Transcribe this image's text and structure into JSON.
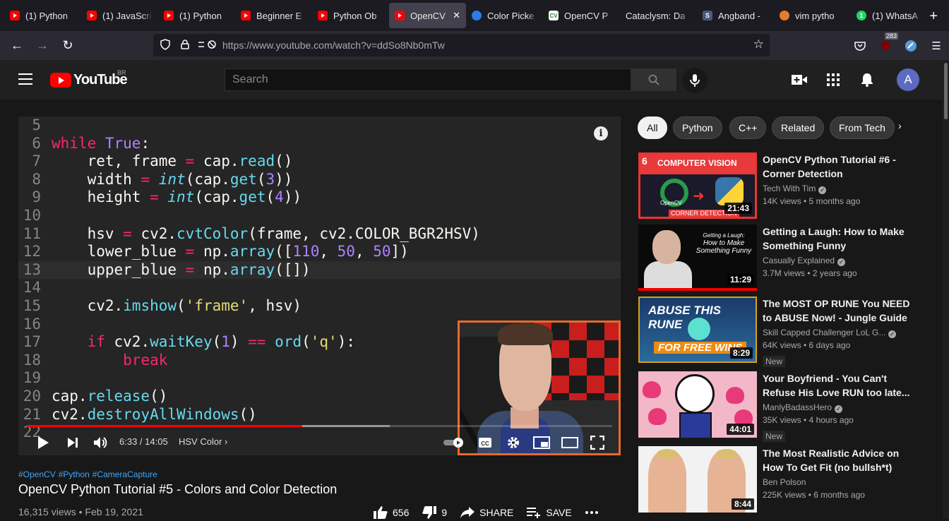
{
  "browser": {
    "tabs": [
      {
        "label": "(1) Python",
        "icon": "youtube-favicon"
      },
      {
        "label": "(1) JavaScri",
        "icon": "youtube-favicon"
      },
      {
        "label": "(1) Python",
        "icon": "youtube-favicon"
      },
      {
        "label": "Beginner E",
        "icon": "youtube-favicon"
      },
      {
        "label": "Python Ob",
        "icon": "youtube-favicon"
      },
      {
        "label": "OpenCV",
        "icon": "youtube-favicon",
        "active": true
      },
      {
        "label": "Color Picke",
        "icon": "color-picker-favicon"
      },
      {
        "label": "OpenCV P",
        "icon": "opencv-favicon"
      },
      {
        "label": "Cataclysm: Da",
        "icon": "none"
      },
      {
        "label": "Angband -",
        "icon": "angband-favicon"
      },
      {
        "label": "vim pytho",
        "icon": "duckduckgo-favicon"
      },
      {
        "label": "(1) WhatsA",
        "icon": "whatsapp-favicon"
      }
    ],
    "url": "https://www.youtube.com/watch?v=ddSo8Nb0mTw",
    "extension_badge": "283"
  },
  "youtube": {
    "logo_text": "YouTube",
    "country": "BR",
    "search_placeholder": "Search",
    "avatar_letter": "A"
  },
  "player": {
    "code_lines": [
      {
        "n": "5",
        "html": ""
      },
      {
        "n": "6",
        "html": "<span class='k'>while</span> <span class='kc'>True</span><span class='tx'>:</span>"
      },
      {
        "n": "7",
        "html": "<span class='tx'>    ret, frame </span><span class='op'>=</span><span class='tx'> cap.</span><span class='fn'>read</span><span class='tx'>()</span>"
      },
      {
        "n": "8",
        "html": "<span class='tx'>    width </span><span class='op'>=</span> <span class='it'>int</span><span class='tx'>(cap.</span><span class='fn'>get</span><span class='tx'>(</span><span class='nm'>3</span><span class='tx'>))</span>"
      },
      {
        "n": "9",
        "html": "<span class='tx'>    height </span><span class='op'>=</span> <span class='it'>int</span><span class='tx'>(cap.</span><span class='fn'>get</span><span class='tx'>(</span><span class='nm'>4</span><span class='tx'>))</span>"
      },
      {
        "n": "10",
        "html": ""
      },
      {
        "n": "11",
        "html": "<span class='tx'>    hsv </span><span class='op'>=</span><span class='tx'> cv2.</span><span class='fn'>cvtColor</span><span class='tx'>(frame, cv2.COLOR_BGR2HSV)</span>"
      },
      {
        "n": "12",
        "html": "<span class='tx'>    lower_blue </span><span class='op'>=</span><span class='tx'> np.</span><span class='fn'>array</span><span class='tx'>([</span><span class='nm'>110</span><span class='tx'>, </span><span class='nm'>50</span><span class='tx'>, </span><span class='nm'>50</span><span class='tx'>])</span>"
      },
      {
        "n": "13",
        "html": "<span class='tx'>    upper_blue </span><span class='op'>=</span><span class='tx'> np.</span><span class='fn'>array</span><span class='tx'>([])</span>",
        "current": true
      },
      {
        "n": "14",
        "html": ""
      },
      {
        "n": "15",
        "html": "<span class='tx'>    cv2.</span><span class='fn'>imshow</span><span class='tx'>(</span><span class='st'>'frame'</span><span class='tx'>, hsv)</span>"
      },
      {
        "n": "16",
        "html": ""
      },
      {
        "n": "17",
        "html": "<span class='tx'>    </span><span class='k'>if</span><span class='tx'> cv2.</span><span class='fn'>waitKey</span><span class='tx'>(</span><span class='nm'>1</span><span class='tx'>) </span><span class='op'>==</span> <span class='fn'>ord</span><span class='tx'>(</span><span class='st'>'q'</span><span class='tx'>):</span>"
      },
      {
        "n": "18",
        "html": "<span class='tx'>        </span><span class='k'>break</span>"
      },
      {
        "n": "19",
        "html": ""
      },
      {
        "n": "20",
        "html": "<span class='tx'>cap.</span><span class='fn'>release</span><span class='tx'>()</span>"
      },
      {
        "n": "21",
        "html": "<span class='tx'>cv2.</span><span class='fn'>destroyAllWindows</span><span class='tx'>()</span>"
      },
      {
        "n": "22",
        "html": ""
      }
    ],
    "time": "6:33 / 14:05",
    "chapter": "HSV Color",
    "progress_played_fraction": 0.47,
    "progress_buffered_fraction": 0.62,
    "accent_color": "#ff0000"
  },
  "video": {
    "tags": [
      "#OpenCV",
      "#Python",
      "#CameraCapture"
    ],
    "title": "OpenCV Python Tutorial #5 - Colors and Color Detection",
    "meta": "16,315 views • Feb 19, 2021",
    "likes": "656",
    "dislikes": "9",
    "share_label": "SHARE",
    "save_label": "SAVE"
  },
  "chips": [
    "All",
    "Python",
    "C++",
    "Related",
    "From Tech"
  ],
  "recommendations": [
    {
      "title": "OpenCV Python Tutorial #6 - Corner Detection",
      "channel": "Tech With Tim",
      "verified": true,
      "views": "14K views • 5 months ago",
      "duration": "21:43",
      "thumb_num": "6",
      "thumb_banner": "COMPUTER VISION",
      "thumb_sub": "CORNER DETECTION",
      "thumb_logo": "OpenCV",
      "new": false
    },
    {
      "title": "Getting a Laugh: How to Make Something Funny",
      "channel": "Casually Explained",
      "verified": true,
      "views": "3.7M views • 2 years ago",
      "duration": "11:29",
      "thumb_text_small": "Getting a Laugh:",
      "thumb_text": "How to Make Something Funny",
      "new": false
    },
    {
      "title": "The MOST OP RUNE You NEED to ABUSE Now! - Jungle Guide",
      "channel": "Skill Capped Challenger LoL G...",
      "verified": true,
      "views": "64K views • 6 days ago",
      "duration": "8:29",
      "thumb_text": "ABUSE THIS RUNE",
      "thumb_text2": "FOR FREE WINS",
      "new": true
    },
    {
      "title": "Your Boyfriend - You Can't Refuse His Love RUN too late...",
      "channel": "ManlyBadassHero",
      "verified": true,
      "views": "35K views • 4 hours ago",
      "duration": "44:01",
      "new": true
    },
    {
      "title": "The Most Realistic Advice on How To Get Fit (no bullsh*t)",
      "channel": "Ben Polson",
      "verified": false,
      "views": "225K views • 6 months ago",
      "duration": "8:44",
      "new": false
    }
  ],
  "new_badge": "New"
}
